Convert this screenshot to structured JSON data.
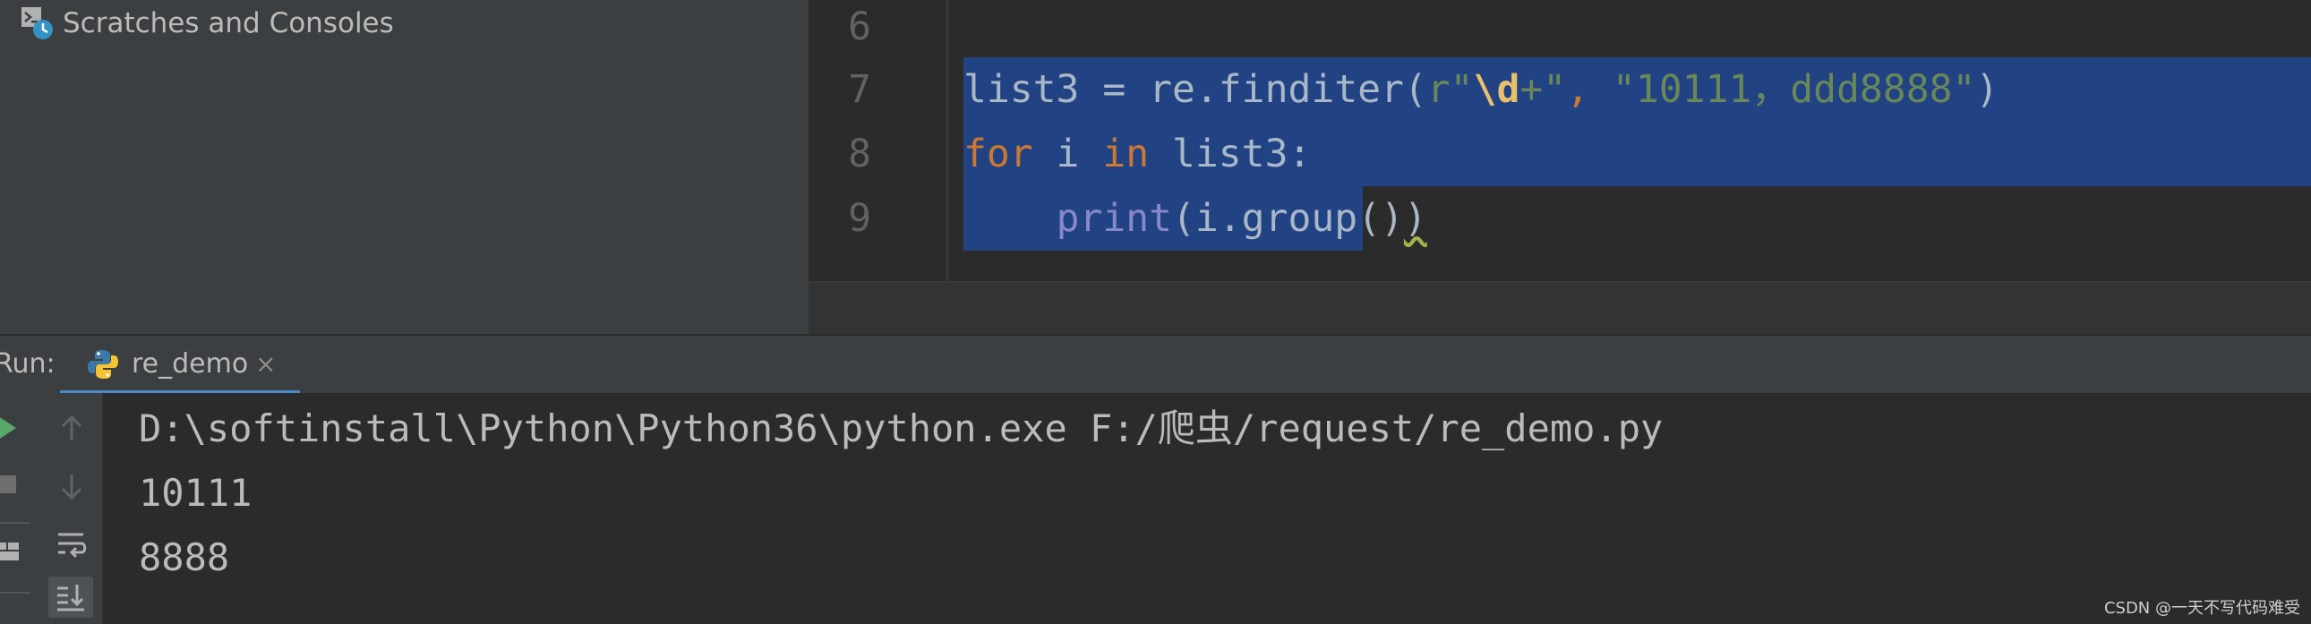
{
  "project": {
    "scratches_label": "Scratches and Consoles"
  },
  "editor": {
    "lines": [
      {
        "number": "6"
      },
      {
        "number": "7"
      },
      {
        "number": "8"
      },
      {
        "number": "9"
      }
    ],
    "code": {
      "l7_var": "list3",
      "l7_eq": " = ",
      "l7_call": "re.finditer(",
      "l7_prefix": "r\"",
      "l7_esc": "\\d",
      "l7_plus": "+\"",
      "l7_comma": ", ",
      "l7_str2": "\"10111，ddd8888\"",
      "l7_close": ")",
      "l8_for": "for",
      "l8_mid": " i ",
      "l8_in": "in",
      "l8_rest": " list3:",
      "l9_indent": "    ",
      "l9_print": "print",
      "l9_args": "(i.group()",
      "l9_last": ")"
    }
  },
  "run": {
    "label": "Run:",
    "tab_label": "re_demo",
    "tab_close": "×"
  },
  "console": {
    "command": "D:\\softinstall\\Python\\Python36\\python.exe F:/爬虫/request/re_demo.py",
    "output_1": "10111",
    "output_2": "8888"
  },
  "watermark": "CSDN @一天不写代码难受",
  "colors": {
    "selection": "#214283",
    "keyword": "#cc7832",
    "string": "#6a8759",
    "escape": "#e8bf6a",
    "builtin": "#8888c6",
    "run_green": "#59a869",
    "tab_underline": "#4a88c7"
  }
}
